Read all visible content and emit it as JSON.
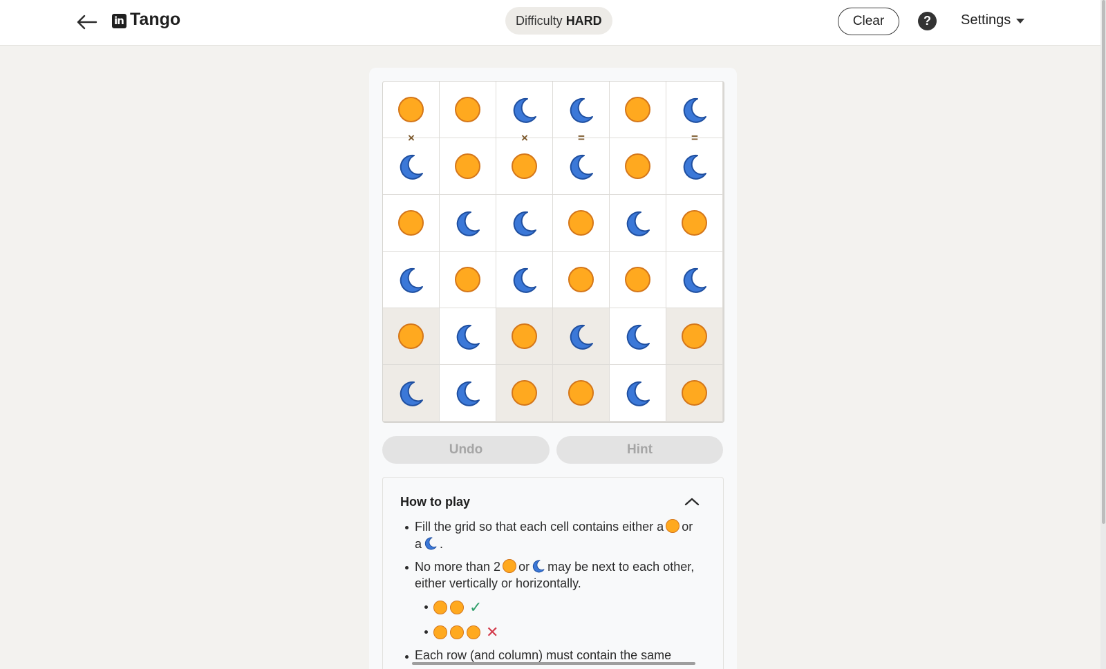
{
  "header": {
    "app_name": "Tango",
    "logo_text": "in",
    "difficulty_label": "Difficulty",
    "difficulty_value": "HARD",
    "clear_label": "Clear",
    "help_symbol": "?",
    "settings_label": "Settings"
  },
  "board": {
    "rows": 6,
    "cols": 6,
    "cells": [
      [
        "sun",
        "sun",
        "moon",
        "moon",
        "sun",
        "moon"
      ],
      [
        "moon",
        "sun",
        "sun",
        "moon",
        "sun",
        "moon"
      ],
      [
        "sun",
        "moon",
        "moon",
        "sun",
        "moon",
        "sun"
      ],
      [
        "moon",
        "sun",
        "moon",
        "sun",
        "sun",
        "moon"
      ],
      [
        "sun",
        "moon",
        "sun",
        "moon",
        "moon",
        "sun"
      ],
      [
        "moon",
        "moon",
        "sun",
        "sun",
        "moon",
        "sun"
      ]
    ],
    "shaded": [
      [
        false,
        false,
        false,
        false,
        false,
        false
      ],
      [
        false,
        false,
        false,
        false,
        false,
        false
      ],
      [
        false,
        false,
        false,
        false,
        false,
        false
      ],
      [
        false,
        false,
        false,
        false,
        false,
        false
      ],
      [
        true,
        false,
        true,
        true,
        false,
        true
      ],
      [
        true,
        false,
        true,
        true,
        false,
        true
      ]
    ],
    "constraints": [
      {
        "row": 0,
        "col": 0,
        "dir": "down",
        "symbol": "×"
      },
      {
        "row": 0,
        "col": 2,
        "dir": "down",
        "symbol": "×"
      },
      {
        "row": 0,
        "col": 3,
        "dir": "down",
        "symbol": "="
      },
      {
        "row": 0,
        "col": 5,
        "dir": "down",
        "symbol": "="
      }
    ],
    "colors": {
      "sun": "#ffa91f",
      "sun_border": "#d4761a",
      "moon": "#3b78d8"
    }
  },
  "controls": {
    "undo_label": "Undo",
    "hint_label": "Hint"
  },
  "how_to_play": {
    "title": "How to play",
    "rule1_a": "Fill the grid so that each cell contains either a",
    "rule1_b": "or",
    "rule1_c": "a",
    "rule1_d": ".",
    "rule2_a": "No more than 2",
    "rule2_b": "or",
    "rule2_c": "may be next to each other,",
    "rule2_d": "either vertically or horizontally.",
    "example_ok_mark": "✓",
    "example_bad_mark": "✕",
    "rule3_a": "Each row (and column) must contain the same"
  }
}
